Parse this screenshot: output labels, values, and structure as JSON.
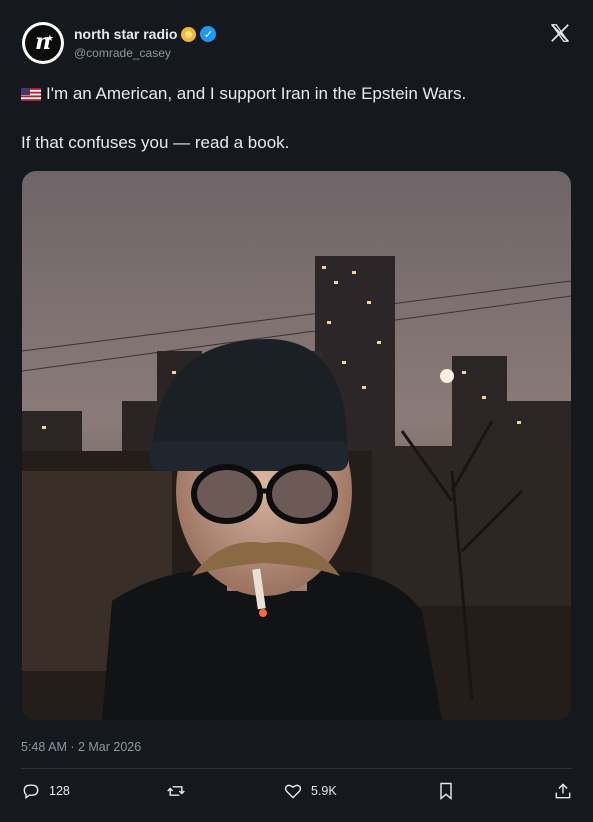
{
  "profile": {
    "display_name": "north star radio",
    "handle": "@comrade_casey",
    "avatar_letter": "n"
  },
  "tweet": {
    "flag": "us-flag",
    "line1": "I'm an American, and I support Iran in the Epstein Wars.",
    "line2": "If that confuses you — read a book.",
    "timestamp": "5:48 AM · 2 Mar 2026"
  },
  "media": {
    "description_icon": "photo-of-man-in-beanie-smoking-with-city-skyline-at-night"
  },
  "actions": {
    "replies": "128",
    "likes": "5.9K"
  },
  "colors": {
    "background": "#15181d",
    "text": "#e7e9ea",
    "muted": "#8b98a5",
    "verified": "#1d9bf0",
    "gold_badge": "#f3ba2f"
  }
}
